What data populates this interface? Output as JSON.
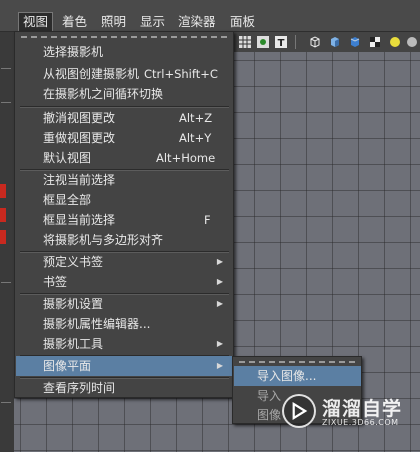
{
  "menubar": {
    "items": [
      "视图",
      "着色",
      "照明",
      "显示",
      "渲染器",
      "面板"
    ],
    "active": "视图"
  },
  "menu": {
    "items": [
      {
        "label": "选择摄影机",
        "shortcut": "",
        "submenu": false
      },
      {
        "label": "从视图创建摄影机",
        "shortcut": "Ctrl+Shift+C",
        "submenu": false
      },
      {
        "label": "在摄影机之间循环切换",
        "shortcut": "",
        "submenu": false
      },
      {
        "label": "撤消视图更改",
        "shortcut": "Alt+Z",
        "submenu": false
      },
      {
        "label": "重做视图更改",
        "shortcut": "Alt+Y",
        "submenu": false
      },
      {
        "label": "默认视图",
        "shortcut": "Alt+Home",
        "submenu": false
      },
      {
        "label": "注视当前选择",
        "shortcut": "",
        "submenu": false
      },
      {
        "label": "框显全部",
        "shortcut": "",
        "submenu": false
      },
      {
        "label": "框显当前选择",
        "shortcut": "F",
        "submenu": false
      },
      {
        "label": "将摄影机与多边形对齐",
        "shortcut": "",
        "submenu": false
      },
      {
        "label": "预定义书签",
        "shortcut": "",
        "submenu": true
      },
      {
        "label": "书签",
        "shortcut": "",
        "submenu": true
      },
      {
        "label": "摄影机设置",
        "shortcut": "",
        "submenu": true
      },
      {
        "label": "摄影机属性编辑器...",
        "shortcut": "",
        "submenu": false
      },
      {
        "label": "摄影机工具",
        "shortcut": "",
        "submenu": true
      },
      {
        "label": "图像平面",
        "shortcut": "",
        "submenu": true,
        "highlighted": true
      },
      {
        "label": "查看序列时间",
        "shortcut": "",
        "submenu": false
      }
    ]
  },
  "submenu": {
    "items": [
      {
        "label": "导入图像...",
        "highlighted": true
      },
      {
        "label": "导入",
        "highlighted": false
      },
      {
        "label": "图像",
        "highlighted": false
      }
    ]
  },
  "toolbar": {
    "icons": [
      "grid-icon",
      "camera-icon",
      "texture-icon",
      "wireframe-cube-icon",
      "shaded-cube-icon",
      "textured-cube-icon",
      "checker-icon",
      "light-icon",
      "sphere-icon"
    ]
  },
  "watermark": {
    "name": "溜溜自学",
    "url": "ZIXUE.3D66.COM"
  },
  "colors": {
    "highlight": "#5b7fa3",
    "menu_bg": "#444444",
    "viewport_bg": "#6e7078"
  }
}
